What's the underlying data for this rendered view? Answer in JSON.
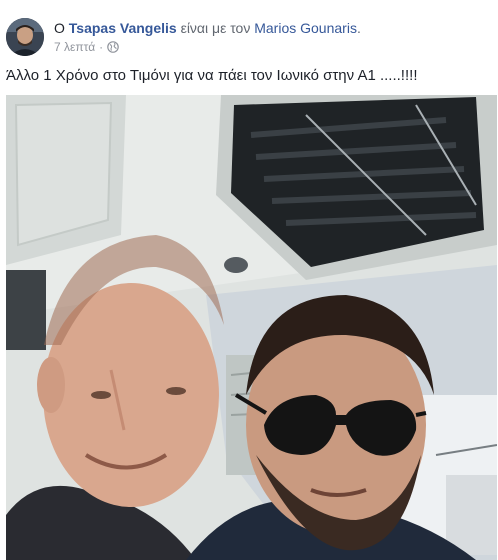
{
  "post": {
    "prefix": "Ο",
    "author": "Tsapas Vangelis",
    "with_text": "είναι με τον",
    "tagged": "Marios Gounaris",
    "suffix": ".",
    "time": "7 λεπτά",
    "separator": "·",
    "audience_icon": "globe-icon",
    "text": "Άλλο 1 Χρόνο στο Τιμόνι για να πάει τον Ιωνικό στην Α1 .....!!!!"
  },
  "photo": {
    "icon": "selfie-photo"
  },
  "colors": {
    "link": "#365899",
    "text": "#1d2129",
    "muted": "#90949c"
  }
}
